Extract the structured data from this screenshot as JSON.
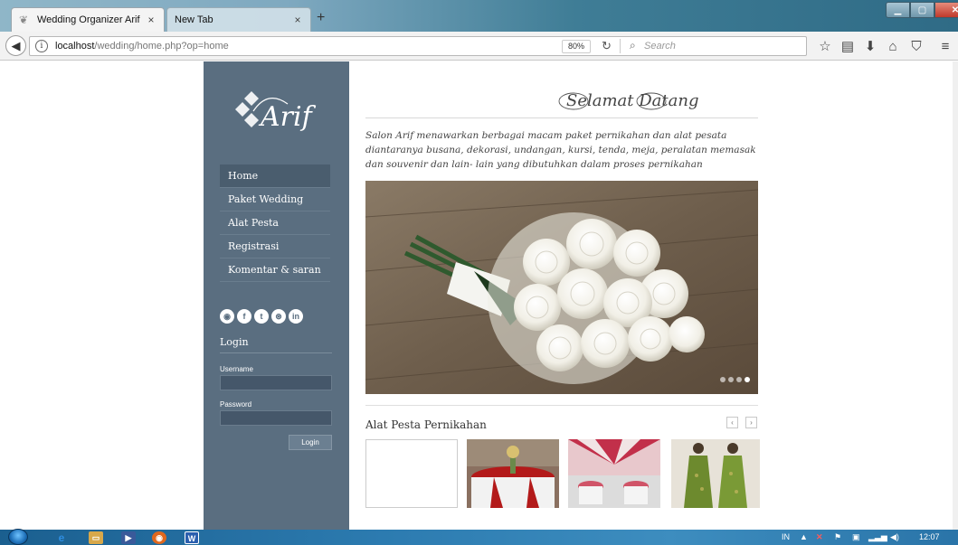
{
  "browser": {
    "tabs": [
      {
        "title": "Wedding Organizer Arif",
        "active": true
      },
      {
        "title": "New Tab",
        "active": false
      }
    ],
    "url_host": "localhost",
    "url_path": "/wedding/home.php?op=home",
    "zoom": "80%",
    "search_placeholder": "Search",
    "close_glyph": "×",
    "new_tab_glyph": "+"
  },
  "site": {
    "logo_text": "Arif",
    "greeting": "Selamat Datang",
    "intro": "Salon Arif menawarkan berbagai macam paket pernikahan dan alat pesata diantaranya busana, dekorasi, undangan, kursi, tenda, meja, peralatan memasak dan souvenir dan lain- lain yang dibutuhkan dalam proses pernikahan",
    "menu": [
      {
        "label": "Home",
        "active": true
      },
      {
        "label": "Paket Wedding",
        "active": false
      },
      {
        "label": "Alat Pesta",
        "active": false
      },
      {
        "label": "Registrasi",
        "active": false
      },
      {
        "label": "Komentar & saran",
        "active": false
      }
    ],
    "social_icons": [
      "rss-icon",
      "facebook-icon",
      "twitter-icon",
      "dribbble-icon",
      "linkedin-icon"
    ],
    "login": {
      "title": "Login",
      "username_label": "Username",
      "password_label": "Password",
      "button_label": "Login"
    },
    "section_title": "Alat Pesta Pernikahan",
    "slider_dots": 4,
    "slider_active_dot": 4,
    "prev_glyph": "‹",
    "next_glyph": "›"
  },
  "taskbar": {
    "lang": "IN",
    "clock": "12:07",
    "word_glyph": "W"
  },
  "colors": {
    "sidebar": "#5a6e80",
    "sidebar_dark": "#4a5d6e",
    "taskbar": "#2c7bb0"
  }
}
